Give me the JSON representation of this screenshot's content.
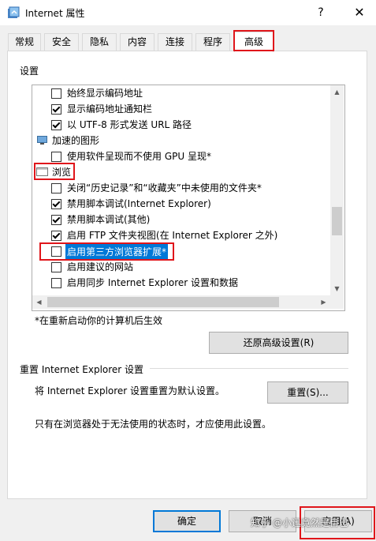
{
  "window": {
    "title": "Internet 属性",
    "help_glyph": "?",
    "close_glyph": "✕"
  },
  "tabs": [
    {
      "label": "常规"
    },
    {
      "label": "安全"
    },
    {
      "label": "隐私"
    },
    {
      "label": "内容"
    },
    {
      "label": "连接"
    },
    {
      "label": "程序"
    },
    {
      "label": "高级",
      "active": true
    }
  ],
  "settings": {
    "label": "设置",
    "items": [
      {
        "type": "checkbox",
        "checked": false,
        "label": "始终显示编码地址"
      },
      {
        "type": "checkbox",
        "checked": true,
        "label": "显示编码地址通知栏"
      },
      {
        "type": "checkbox",
        "checked": true,
        "label": "以 UTF-8 形式发送 URL 路径"
      },
      {
        "type": "category",
        "icon": "monitor-icon",
        "label": "加速的图形"
      },
      {
        "type": "checkbox",
        "checked": false,
        "label": "使用软件呈现而不使用 GPU 呈现*"
      },
      {
        "type": "category",
        "icon": "window-icon",
        "label": "浏览"
      },
      {
        "type": "checkbox",
        "checked": false,
        "label": "关闭“历史记录”和“收藏夹”中未使用的文件夹*"
      },
      {
        "type": "checkbox",
        "checked": true,
        "label": "禁用脚本调试(Internet Explorer)"
      },
      {
        "type": "checkbox",
        "checked": true,
        "label": "禁用脚本调试(其他)"
      },
      {
        "type": "checkbox",
        "checked": true,
        "label": "启用 FTP 文件夹视图(在 Internet Explorer 之外)"
      },
      {
        "type": "checkbox",
        "checked": false,
        "label": "启用第三方浏览器扩展*",
        "selected": true
      },
      {
        "type": "checkbox",
        "checked": false,
        "label": "启用建议的网站"
      },
      {
        "type": "checkbox",
        "checked": false,
        "label": "启用同步 Internet Explorer 设置和数据"
      }
    ],
    "restart_note": "*在重新启动你的计算机后生效",
    "restore_button": "还原高级设置(R)"
  },
  "reset": {
    "group_label": "重置 Internet Explorer 设置",
    "description": "将 Internet Explorer 设置重置为默认设置。",
    "button": "重置(S)...",
    "note": "只有在浏览器处于无法使用的状态时，才应使用此设置。"
  },
  "footer": {
    "ok": "确定",
    "cancel": "取消",
    "apply": "应用(A)"
  },
  "watermark": "知乎 @小迅竟然是自己",
  "colors": {
    "selection": "#0078d7",
    "highlight_box": "#e0161b"
  }
}
